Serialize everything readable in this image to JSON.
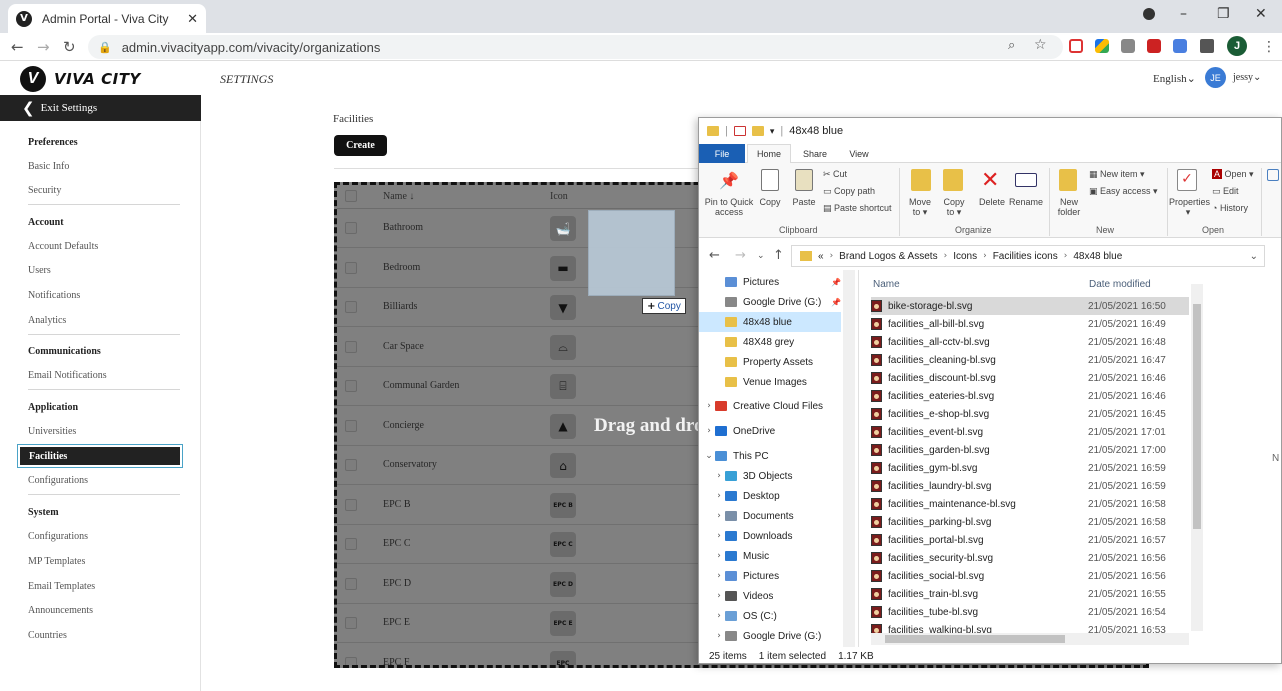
{
  "browser": {
    "tab_title": "Admin Portal - Viva City",
    "tab_close": "✕",
    "url": "admin.vivacityapp.com/vivacity/organizations",
    "profile_initial": "J",
    "win_min": "–",
    "win_max": "❐",
    "win_close": "✕"
  },
  "app": {
    "brand": "VIVA CITY",
    "brand_mark": "V",
    "page_title": "SETTINGS",
    "language": "English",
    "user_initials": "JE",
    "user_name": "jessy"
  },
  "sidebar": {
    "exit_label": "Exit Settings",
    "sections": [
      {
        "title": "Preferences",
        "items": [
          "Basic Info",
          "Security"
        ]
      },
      {
        "title": "Account",
        "items": [
          "Account Defaults",
          "Users",
          "Notifications",
          "Analytics"
        ]
      },
      {
        "title": "Communications",
        "items": [
          "Email Notifications"
        ]
      },
      {
        "title": "Application",
        "items": [
          "Universities",
          "Facilities",
          "Configurations"
        ]
      },
      {
        "title": "System",
        "items": [
          "Configurations",
          "MP Templates",
          "Email Templates",
          "Announcements",
          "Countries"
        ]
      }
    ],
    "active_item": "Facilities"
  },
  "facilities": {
    "heading": "Facilities",
    "create_label": "Create",
    "col_name": "Name ↓",
    "col_icon": "Icon",
    "drag_text": "Drag and drop",
    "copy_tooltip": "Copy",
    "rows": [
      {
        "name": "Bathroom",
        "icon": "bath-icon",
        "glyph": "🛁"
      },
      {
        "name": "Bedroom",
        "icon": "bed-icon",
        "glyph": "▬"
      },
      {
        "name": "Billiards",
        "icon": "billiards-icon",
        "glyph": "▼"
      },
      {
        "name": "Car Space",
        "icon": "car-icon",
        "glyph": "⌓"
      },
      {
        "name": "Communal Garden",
        "icon": "garden-icon",
        "glyph": "⌸"
      },
      {
        "name": "Concierge",
        "icon": "concierge-bell-icon",
        "glyph": "▲"
      },
      {
        "name": "Conservatory",
        "icon": "conservatory-icon",
        "glyph": "⌂"
      },
      {
        "name": "EPC B",
        "icon": "epc-b-icon",
        "glyph": "EPC B"
      },
      {
        "name": "EPC C",
        "icon": "epc-c-icon",
        "glyph": "EPC C"
      },
      {
        "name": "EPC D",
        "icon": "epc-d-icon",
        "glyph": "EPC D"
      },
      {
        "name": "EPC E",
        "icon": "epc-e-icon",
        "glyph": "EPC E"
      },
      {
        "name": "EPC F",
        "icon": "epc-f-icon",
        "glyph": "EPC"
      }
    ]
  },
  "explorer": {
    "title": "48x48 blue",
    "tabs": [
      "File",
      "Home",
      "Share",
      "View"
    ],
    "ribbon": {
      "pin": "Pin to Quick access",
      "copy": "Copy",
      "paste": "Paste",
      "cut": "Cut",
      "copy_path": "Copy path",
      "paste_shortcut": "Paste shortcut",
      "clipboard": "Clipboard",
      "move_to": "Move to ▾",
      "copy_to": "Copy to ▾",
      "delete": "Delete",
      "rename": "Rename",
      "organize": "Organize",
      "new_folder": "New folder",
      "new_item": "New item ▾",
      "easy_access": "Easy access ▾",
      "new": "New",
      "properties": "Properties",
      "open_btn": "Open ▾",
      "edit": "Edit",
      "history": "History",
      "open": "Open"
    },
    "breadcrumb": [
      "«",
      "Brand Logos & Assets",
      "Icons",
      "Facilities icons",
      "48x48 blue"
    ],
    "nav_items": [
      {
        "label": "Pictures",
        "color": "#5b8fd6",
        "arrow": "",
        "indent": 1,
        "pin": "📌"
      },
      {
        "label": "Google Drive (G:)",
        "color": "#888888",
        "arrow": "",
        "indent": 1,
        "pin": "📌"
      },
      {
        "label": "48x48 blue",
        "color": "#e8c048",
        "arrow": "",
        "indent": 1,
        "selected": true
      },
      {
        "label": "48X48 grey",
        "color": "#e8c048",
        "arrow": "",
        "indent": 1
      },
      {
        "label": "Property Assets",
        "color": "#e8c048",
        "arrow": "",
        "indent": 1
      },
      {
        "label": "Venue Images",
        "color": "#e8c048",
        "arrow": "",
        "indent": 1
      },
      {
        "label": "Creative Cloud Files",
        "color": "#d83b2b",
        "arrow": "›",
        "indent": 0
      },
      {
        "label": "OneDrive",
        "color": "#1f6fd1",
        "arrow": "›",
        "indent": 0
      },
      {
        "label": "This PC",
        "color": "#4a8fd6",
        "arrow": "⌄",
        "indent": 0
      },
      {
        "label": "3D Objects",
        "color": "#38a0d6",
        "arrow": "›",
        "indent": 1
      },
      {
        "label": "Desktop",
        "color": "#2a79d0",
        "arrow": "›",
        "indent": 1
      },
      {
        "label": "Documents",
        "color": "#7a8fa8",
        "arrow": "›",
        "indent": 1
      },
      {
        "label": "Downloads",
        "color": "#2a79d0",
        "arrow": "›",
        "indent": 1
      },
      {
        "label": "Music",
        "color": "#2a79d0",
        "arrow": "›",
        "indent": 1
      },
      {
        "label": "Pictures",
        "color": "#5b8fd6",
        "arrow": "›",
        "indent": 1
      },
      {
        "label": "Videos",
        "color": "#555555",
        "arrow": "›",
        "indent": 1
      },
      {
        "label": "OS (C:)",
        "color": "#6a9fd6",
        "arrow": "›",
        "indent": 1
      },
      {
        "label": "Google Drive (G:)",
        "color": "#888888",
        "arrow": "›",
        "indent": 1
      }
    ],
    "col_name": "Name",
    "col_date": "Date modified",
    "files": [
      {
        "name": "bike-storage-bl.svg",
        "date": "21/05/2021 16:50",
        "selected": true
      },
      {
        "name": "facilities_all-bill-bl.svg",
        "date": "21/05/2021 16:49"
      },
      {
        "name": "facilities_all-cctv-bl.svg",
        "date": "21/05/2021 16:48"
      },
      {
        "name": "facilities_cleaning-bl.svg",
        "date": "21/05/2021 16:47"
      },
      {
        "name": "facilities_discount-bl.svg",
        "date": "21/05/2021 16:46"
      },
      {
        "name": "facilities_eateries-bl.svg",
        "date": "21/05/2021 16:46"
      },
      {
        "name": "facilities_e-shop-bl.svg",
        "date": "21/05/2021 16:45"
      },
      {
        "name": "facilities_event-bl.svg",
        "date": "21/05/2021 17:01"
      },
      {
        "name": "facilities_garden-bl.svg",
        "date": "21/05/2021 17:00"
      },
      {
        "name": "facilities_gym-bl.svg",
        "date": "21/05/2021 16:59"
      },
      {
        "name": "facilities_laundry-bl.svg",
        "date": "21/05/2021 16:59"
      },
      {
        "name": "facilities_maintenance-bl.svg",
        "date": "21/05/2021 16:58"
      },
      {
        "name": "facilities_parking-bl.svg",
        "date": "21/05/2021 16:58"
      },
      {
        "name": "facilities_portal-bl.svg",
        "date": "21/05/2021 16:57"
      },
      {
        "name": "facilities_security-bl.svg",
        "date": "21/05/2021 16:56"
      },
      {
        "name": "facilities_social-bl.svg",
        "date": "21/05/2021 16:56"
      },
      {
        "name": "facilities_train-bl.svg",
        "date": "21/05/2021 16:55"
      },
      {
        "name": "facilities_tube-bl.svg",
        "date": "21/05/2021 16:54"
      },
      {
        "name": "facilities_walking-bl.svg",
        "date": "21/05/2021 16:53"
      }
    ],
    "status_count": "25 items",
    "status_selected": "1 item selected",
    "status_size": "1.17 KB"
  },
  "right_edge_letter": "N"
}
